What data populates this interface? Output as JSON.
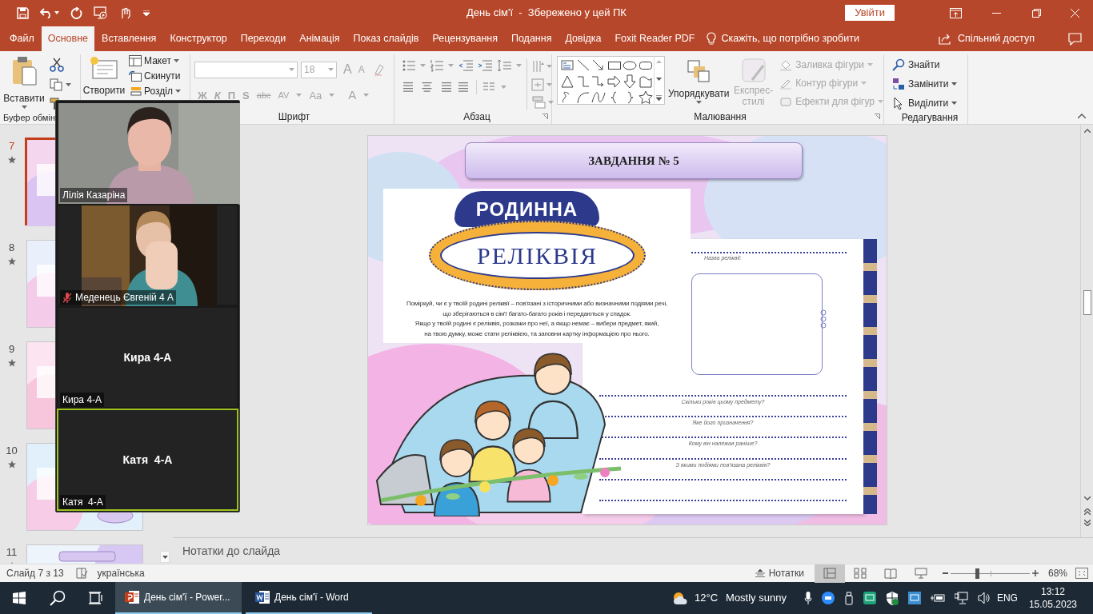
{
  "title_bar": {
    "title": "День сім'ї  -  Збережено у цей ПК",
    "sign_in": "Увійти"
  },
  "ribbon_tabs": [
    {
      "label": "Файл",
      "selected": false
    },
    {
      "label": "Основне",
      "selected": true
    },
    {
      "label": "Вставлення",
      "selected": false
    },
    {
      "label": "Конструктор",
      "selected": false
    },
    {
      "label": "Переходи",
      "selected": false
    },
    {
      "label": "Анімація",
      "selected": false
    },
    {
      "label": "Показ слайдів",
      "selected": false
    },
    {
      "label": "Рецензування",
      "selected": false
    },
    {
      "label": "Подання",
      "selected": false
    },
    {
      "label": "Довідка",
      "selected": false
    },
    {
      "label": "Foxit Reader PDF",
      "selected": false
    }
  ],
  "tell_me": "Скажіть, що потрібно зробити",
  "share": "Спільний доступ",
  "ribbon": {
    "clipboard": {
      "paste": "Вставити",
      "label": "Буфер обмін"
    },
    "slides": {
      "new_slide": "Створити",
      "layout": "Макет",
      "reset": "Скинути",
      "section": "Розділ"
    },
    "font": {
      "size": "18",
      "grow": "A",
      "shrink": "A",
      "styles": [
        "Ж",
        "К",
        "П",
        "S",
        "abc"
      ],
      "spacing": "AV",
      "case": "Aa",
      "font_color_button": "A",
      "disabled": true,
      "label": "Шрифт"
    },
    "paragraph": {
      "label": "Абзац"
    },
    "drawing": {
      "arrange": "Упорядкувати",
      "quick_styles": "Експрес-стилі",
      "quick_styles_disabled": true,
      "format_items": [
        {
          "label": "Заливка фігури",
          "disabled": true
        },
        {
          "label": "Контур фігури",
          "disabled": true
        },
        {
          "label": "Ефекти для фігур",
          "disabled": true
        }
      ],
      "label": "Малювання"
    },
    "editing": {
      "items": [
        {
          "kind": "find",
          "label": "Знайти",
          "dropdown": false
        },
        {
          "kind": "replace",
          "label": "Замінити",
          "dropdown": true
        },
        {
          "kind": "select",
          "label": "Виділити",
          "dropdown": true
        }
      ],
      "label": "Редагування"
    }
  },
  "slides_pane": [
    {
      "number": "7",
      "selected": true
    },
    {
      "number": "8",
      "selected": false
    },
    {
      "number": "9",
      "selected": false
    },
    {
      "number": "10",
      "selected": false
    },
    {
      "number": "11",
      "selected": false
    }
  ],
  "zoom_panel": [
    {
      "name": "Лілія Казаріна",
      "kind": "video",
      "muted": false,
      "active": false
    },
    {
      "name": "Меденець Євгеній 4 А",
      "kind": "video",
      "muted": true,
      "active": false
    },
    {
      "name": "Кира 4-А",
      "kind": "no_video",
      "center_name": "Кира 4-А",
      "muted": false,
      "active": false
    },
    {
      "name": "Катя  4-А",
      "kind": "no_video",
      "center_name": "Катя  4-А",
      "muted": false,
      "active": true
    }
  ],
  "slide": {
    "title": "ЗАВДАННЯ № 5",
    "logo_top": "РОДИННА",
    "logo_bottom": "РЕЛІКВІЯ",
    "description_lines": [
      "Поміркуй, чи є у твоїй родині реліквії – пов'язані з історичними або визначними подіями речі,",
      "що зберігаються в сім'ї багато-багато років і передаються у спадок.",
      "Якщо у твоїй родині є реліквія, розкажи про неї, а якщо немає – вибери предмет, який,",
      "на твою думку, може стати реліквією, та заповни картку інформацією про нього."
    ],
    "form": {
      "name_label": "Назва реліквії:",
      "questions": [
        "Скільки років цьому предмету?",
        "Яке його призначення?",
        "Кому він належав раніше?",
        "З якими подіями пов'язана реліквія?"
      ]
    }
  },
  "notes_placeholder": "Нотатки до слайда",
  "status_bar": {
    "slide_counter": "Слайд 7 з 13",
    "language": "українська",
    "notes_button": "Нотатки",
    "views": [
      {
        "kind": "normal",
        "selected": true
      },
      {
        "kind": "sorter",
        "selected": false
      },
      {
        "kind": "reading",
        "selected": false
      },
      {
        "kind": "slideshow",
        "selected": false
      }
    ],
    "zoom": {
      "level": 0.33,
      "value": "68%"
    }
  },
  "taskbar": {
    "apps": [
      {
        "kind": "powerpoint",
        "label": "День сім'ї - Power...",
        "selected": true
      },
      {
        "kind": "word",
        "label": "День сім'ї - Word",
        "selected": false
      }
    ],
    "weather": {
      "temperature": "12°C",
      "condition": "Mostly sunny"
    },
    "language": "ENG",
    "time": "13:12",
    "date": "15.05.2023"
  }
}
